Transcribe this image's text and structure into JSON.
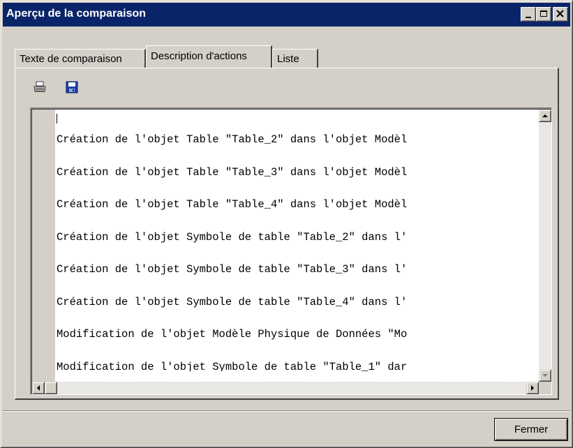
{
  "window": {
    "title": "Aperçu de la comparaison",
    "controls": {
      "minimize": "minimize-icon",
      "maximize": "maximize-icon",
      "close": "close-icon"
    }
  },
  "tabs": [
    {
      "label": "Texte de comparaison",
      "active": false
    },
    {
      "label": "Description d'actions",
      "active": true
    },
    {
      "label": "Liste",
      "active": false
    }
  ],
  "toolbar": {
    "print_icon": "print-icon",
    "save_icon": "save-icon"
  },
  "actions_text": {
    "lines": [
      "Création de l'objet Table \"Table_2\" dans l'objet Modèl",
      "Création de l'objet Table \"Table_3\" dans l'objet Modèl",
      "Création de l'objet Table \"Table_4\" dans l'objet Modèl",
      "Création de l'objet Symbole de table \"Table_2\" dans l'",
      "Création de l'objet Symbole de table \"Table_3\" dans l'",
      "Création de l'objet Symbole de table \"Table_4\" dans l'",
      "Modification de l'objet Modèle Physique de Données \"Mo",
      "Modification de l'objet Symbole de table \"Table_1\" dar"
    ]
  },
  "footer": {
    "close_label": "Fermer"
  },
  "colors": {
    "titlebar": "#0a246a",
    "face": "#d4d0c8",
    "text_bg": "#ffffff"
  }
}
